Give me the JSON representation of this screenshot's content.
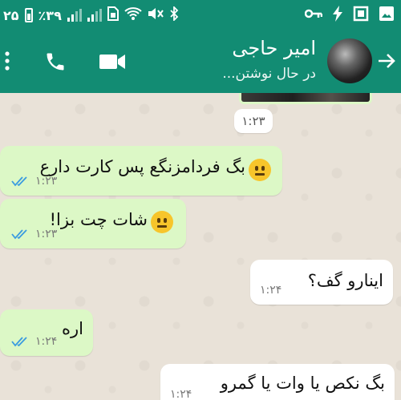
{
  "status": {
    "time": "۲۵",
    "battery": "٪۳۹",
    "icons": [
      "battery-icon",
      "signal-icon",
      "signal-icon",
      "sim-icon",
      "wifi-icon",
      "mute-icon",
      "bluetooth-icon",
      "key-icon",
      "flash-icon",
      "screenshot-icon",
      "image-icon"
    ]
  },
  "header": {
    "title": "امیر حاجی",
    "subtitle": "در حال نوشتن...",
    "icons": [
      "back-arrow-icon",
      "avatar",
      "video-call-icon",
      "phone-icon",
      "more-menu-icon"
    ]
  },
  "chat": {
    "date_stamp": "۱:۲۳",
    "messages": [
      {
        "dir": "out",
        "text": "بگ فردامزنگع پس کارت دارع",
        "time": "۱:۲۳",
        "ticks": "double-check-icon",
        "emoji": "neutral-face"
      },
      {
        "dir": "out",
        "text": "شات چت بزا!",
        "time": "۱:۲۳",
        "ticks": "double-check-icon",
        "emoji": "neutral-face"
      },
      {
        "dir": "in",
        "text": "اینارو گف؟",
        "time": "۱:۲۴"
      },
      {
        "dir": "out",
        "text": "اره",
        "time": "۱:۲۴",
        "ticks": "double-check-icon"
      },
      {
        "dir": "in",
        "text": "بگ نکص یا وات یا گمرو",
        "time": "۱:۲۴"
      }
    ]
  },
  "colors": {
    "header": "#128c73",
    "outgoing": "#dcf8c6",
    "incoming": "#ffffff",
    "tick": "#3a9be0",
    "chat_bg": "#e9e2d8"
  }
}
